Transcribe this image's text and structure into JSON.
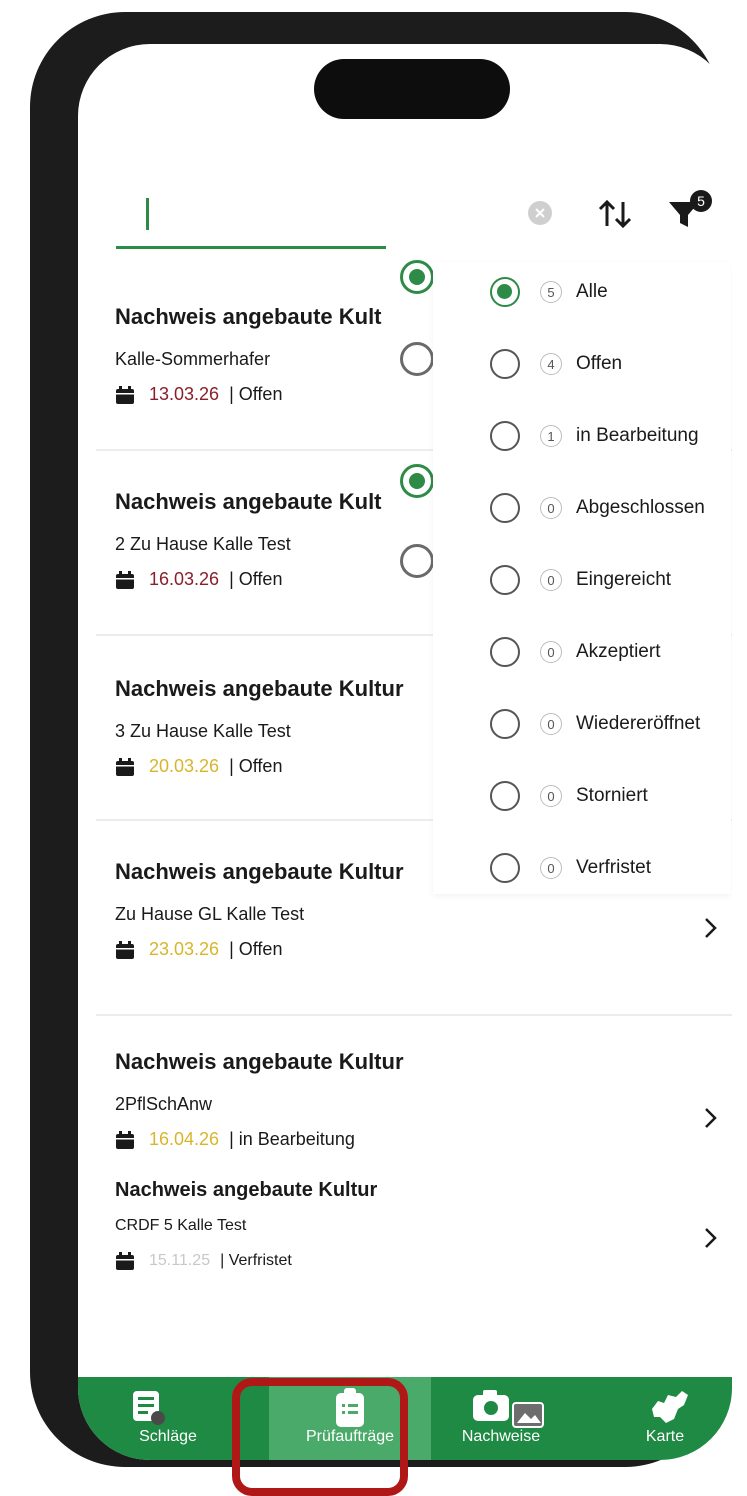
{
  "search": {
    "value": ""
  },
  "filter": {
    "badge": "5"
  },
  "cards": [
    {
      "title": "Nachweis angebaute Kult",
      "subtitle": "Kalle-Sommerhafer",
      "date": "13.03.26",
      "status": "| Offen",
      "date_color": "#8a1e2a"
    },
    {
      "title": "Nachweis angebaute Kult",
      "subtitle": "2 Zu Hause Kalle Test",
      "date": "16.03.26",
      "status": "| Offen",
      "date_color": "#8a1e2a"
    },
    {
      "title": "Nachweis angebaute Kultur",
      "subtitle": "3 Zu Hause Kalle Test",
      "date": "20.03.26",
      "status": "| Offen",
      "date_color": "#d9b52c"
    },
    {
      "title": "Nachweis angebaute Kultur",
      "subtitle": "Zu Hause GL Kalle Test",
      "date": "23.03.26",
      "status": "| Offen",
      "date_color": "#d9b52c"
    },
    {
      "title": "Nachweis angebaute Kultur",
      "subtitle": "2PflSchAnw",
      "date": "16.04.26",
      "status": "| in Bearbeitung",
      "date_color": "#d9b52c"
    },
    {
      "title": "Nachweis angebaute Kultur",
      "subtitle": "CRDF 5 Kalle Test",
      "date": "15.11.25",
      "status": "| Verfristet",
      "date_color": "#c8c8c8"
    }
  ],
  "filter_options": [
    {
      "count": "5",
      "label": "Alle",
      "selected": true
    },
    {
      "count": "4",
      "label": "Offen",
      "selected": false
    },
    {
      "count": "1",
      "label": "in Bearbeitung",
      "selected": false
    },
    {
      "count": "0",
      "label": "Abgeschlossen",
      "selected": false
    },
    {
      "count": "0",
      "label": "Eingereicht",
      "selected": false
    },
    {
      "count": "0",
      "label": "Akzeptiert",
      "selected": false
    },
    {
      "count": "0",
      "label": "Wiedereröffnet",
      "selected": false
    },
    {
      "count": "0",
      "label": "Storniert",
      "selected": false
    },
    {
      "count": "0",
      "label": "Verfristet",
      "selected": false
    }
  ],
  "tabs": [
    {
      "label": "Schläge",
      "icon": "fields-list-icon"
    },
    {
      "label": "Prüfaufträge",
      "icon": "clipboard-icon",
      "active": true
    },
    {
      "label": "Nachweise",
      "icon": "camera-gallery-icon"
    },
    {
      "label": "Karte",
      "icon": "map-icon"
    }
  ],
  "colors": {
    "brand_green": "#1f8a44",
    "active_tab": "#4aaa6a",
    "highlight": "#b01818"
  }
}
